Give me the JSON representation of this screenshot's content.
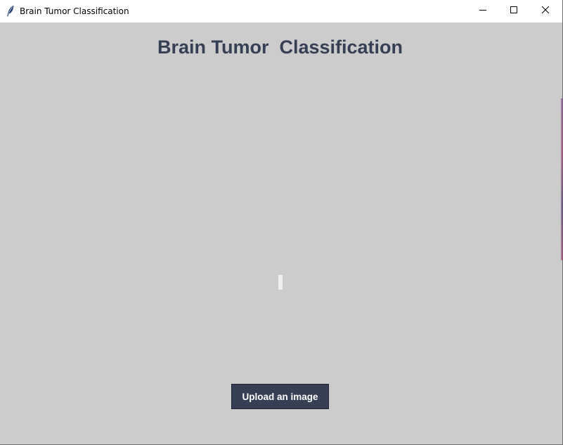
{
  "window": {
    "title": "Brain Tumor Classification",
    "icons": {
      "app": "feather-icon",
      "minimize": "minimize-icon",
      "maximize": "maximize-icon",
      "close": "close-icon"
    }
  },
  "main": {
    "heading": "Brain Tumor  Classification",
    "upload_button_label": "Upload an image"
  },
  "colors": {
    "background": "#cccccc",
    "accent": "#363f54",
    "button_text": "#ffffff"
  }
}
